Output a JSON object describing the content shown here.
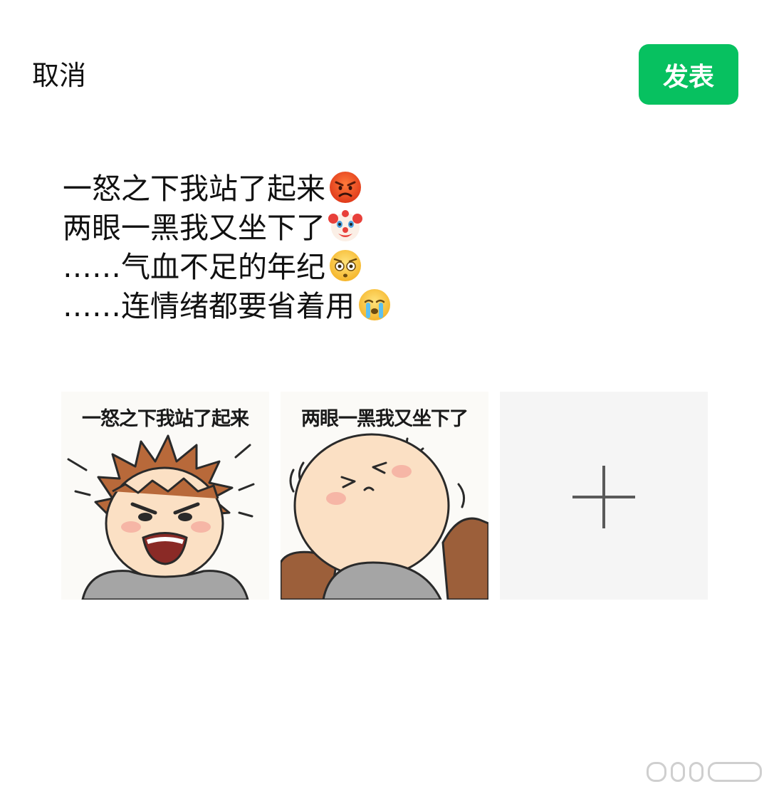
{
  "header": {
    "cancel_label": "取消",
    "publish_label": "发表"
  },
  "post": {
    "lines": [
      {
        "text": "一怒之下我站了起来",
        "emoji": "angry-face-icon"
      },
      {
        "text": "两眼一黑我又坐下了",
        "emoji": "clown-face-icon"
      },
      {
        "text": "……气血不足的年纪",
        "emoji": "flushed-face-icon"
      },
      {
        "text": "……连情绪都要省着用",
        "emoji": "crying-face-icon"
      }
    ]
  },
  "images": [
    {
      "caption": "一怒之下我站了起来"
    },
    {
      "caption": "两眼一黑我又坐下了"
    }
  ],
  "add_tile": {
    "icon": "plus-icon"
  },
  "colors": {
    "accent": "#07c160",
    "add_tile_bg": "#f5f5f5"
  }
}
